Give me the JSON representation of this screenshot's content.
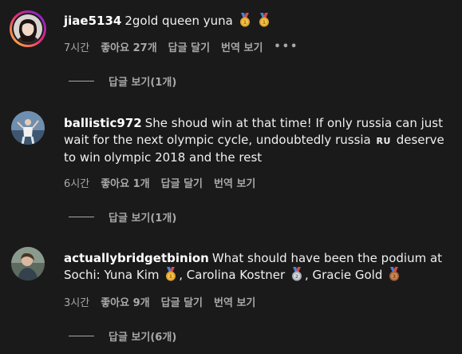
{
  "comments": [
    {
      "username": "jiae5134",
      "text": "2gold queen yuna",
      "time": "7시간",
      "likes": "좋아요 27개",
      "reply": "답글 달기",
      "translate": "번역 보기",
      "more": "•••",
      "view_replies": "답글 보기(1개)"
    },
    {
      "username": "ballistic972",
      "text_a": "She shoud win at that time! If only russia can just wait for the next olympic cycle, undoubtedly russia",
      "flag": "RU",
      "text_b": "deserve to win olympic 2018 and the rest",
      "time": "6시간",
      "likes": "좋아요 1개",
      "reply": "답글 달기",
      "translate": "번역 보기",
      "view_replies": "답글 보기(1개)"
    },
    {
      "username": "actuallybridgetbinion",
      "text_a": "What should have been the podium at Sochi: Yuna Kim",
      "text_b": ", Carolina Kostner",
      "text_c": ", Gracie Gold",
      "time": "3시간",
      "likes": "좋아요 9개",
      "reply": "답글 달기",
      "translate": "번역 보기",
      "view_replies": "답글 보기(6개)"
    }
  ],
  "colors": {
    "background": "#1a1a1a",
    "text": "#f0f0f0",
    "meta": "#a8a8a8",
    "gold": "#e0a32e",
    "silver": "#c0c4cc",
    "bronze": "#c07a45"
  },
  "icons": [
    "gold-medal-icon",
    "silver-medal-icon",
    "bronze-medal-icon",
    "more-options-icon"
  ]
}
